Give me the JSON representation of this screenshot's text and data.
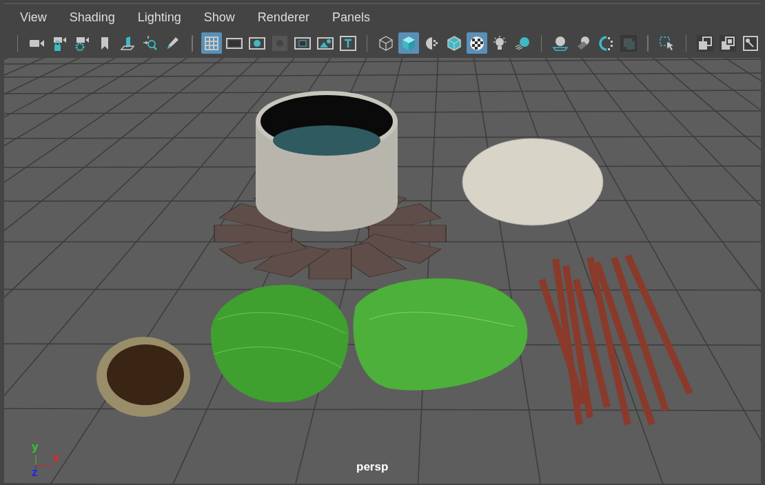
{
  "menus": [
    {
      "label": "View"
    },
    {
      "label": "Shading"
    },
    {
      "label": "Lighting"
    },
    {
      "label": "Show"
    },
    {
      "label": "Renderer"
    },
    {
      "label": "Panels"
    }
  ],
  "toolbar": {
    "groups": [
      {
        "buttons": [
          {
            "selected": false
          },
          {
            "selected": false
          },
          {
            "selected": false
          },
          {
            "selected": false
          },
          {
            "selected": false
          },
          {
            "selected": false
          },
          {
            "selected": false
          }
        ]
      },
      {
        "buttons": [
          {
            "selected": true
          },
          {
            "selected": false
          },
          {
            "selected": false
          },
          {
            "selected": false
          },
          {
            "selected": false
          },
          {
            "selected": false
          },
          {
            "selected": false
          }
        ]
      },
      {
        "buttons": [
          {
            "selected": false
          },
          {
            "selected": true
          },
          {
            "selected": false
          },
          {
            "selected": false
          },
          {
            "selected": true
          },
          {
            "selected": false
          },
          {
            "selected": false
          }
        ]
      },
      {
        "buttons": [
          {
            "selected": false
          },
          {
            "selected": false
          },
          {
            "selected": false
          },
          {
            "selected": false
          }
        ]
      },
      {
        "buttons": [
          {
            "selected": false
          }
        ]
      },
      {
        "buttons": [
          {
            "selected": false
          },
          {
            "selected": false
          },
          {
            "selected": false
          }
        ]
      }
    ]
  },
  "viewport": {
    "camera": "persp",
    "axes": {
      "x": "x",
      "y": "y",
      "z": "z"
    }
  }
}
